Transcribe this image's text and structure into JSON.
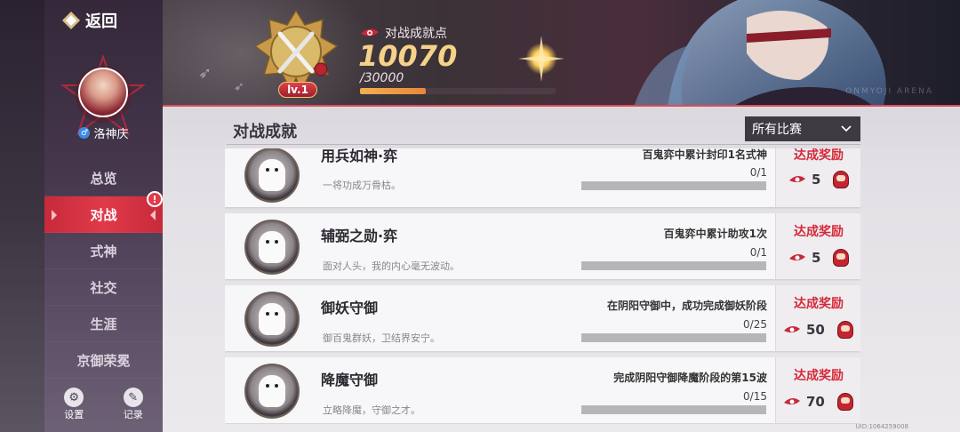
{
  "sidebar": {
    "back_label": "返回",
    "username": "洛神庆",
    "gender_symbol": "♂",
    "nav": [
      {
        "label": "总览",
        "active": false
      },
      {
        "label": "对战",
        "active": true,
        "alert": "!"
      },
      {
        "label": "式神",
        "active": false
      },
      {
        "label": "社交",
        "active": false
      },
      {
        "label": "生涯",
        "active": false
      },
      {
        "label": "京御荣冕",
        "active": false
      }
    ],
    "tools": [
      {
        "label": "设置",
        "icon": "gear-icon"
      },
      {
        "label": "记录",
        "icon": "pen-icon"
      }
    ]
  },
  "banner": {
    "points_label": "对战成就点",
    "points_value": "10070",
    "points_total": "/30000",
    "points_progress": 0.336,
    "level": "lv.1",
    "watermark": "ONMYOJI ARENA"
  },
  "main": {
    "title": "对战成就",
    "filter_value": "所有比赛"
  },
  "achievements": [
    {
      "name": "用兵如神·弈",
      "desc": "一将功成万骨枯。",
      "condition": "百鬼弈中累计封印1名式神",
      "progress": "0/1",
      "progress_ratio": 0,
      "reward_label": "达成奖励",
      "reward_amount": "5"
    },
    {
      "name": "辅弼之勋·弈",
      "desc": "面对人头，我的内心毫无波动。",
      "condition": "百鬼弈中累计助攻1次",
      "progress": "0/1",
      "progress_ratio": 0,
      "reward_label": "达成奖励",
      "reward_amount": "5"
    },
    {
      "name": "御妖守御",
      "desc": "御百鬼群妖，卫结界安宁。",
      "condition": "在阴阳守御中，成功完成御妖阶段",
      "progress": "0/25",
      "progress_ratio": 0,
      "reward_label": "达成奖励",
      "reward_amount": "50"
    },
    {
      "name": "降魔守御",
      "desc": "立略降魔，守御之才。",
      "condition": "完成阴阳守御降魔阶段的第15波",
      "progress": "0/15",
      "progress_ratio": 0,
      "reward_label": "达成奖励",
      "reward_amount": "70"
    }
  ],
  "uid": "UID:1064259008",
  "colors": {
    "accent_red": "#d42a3a",
    "active_nav": "#e03a4a",
    "points_gold": "#f5d28a"
  }
}
